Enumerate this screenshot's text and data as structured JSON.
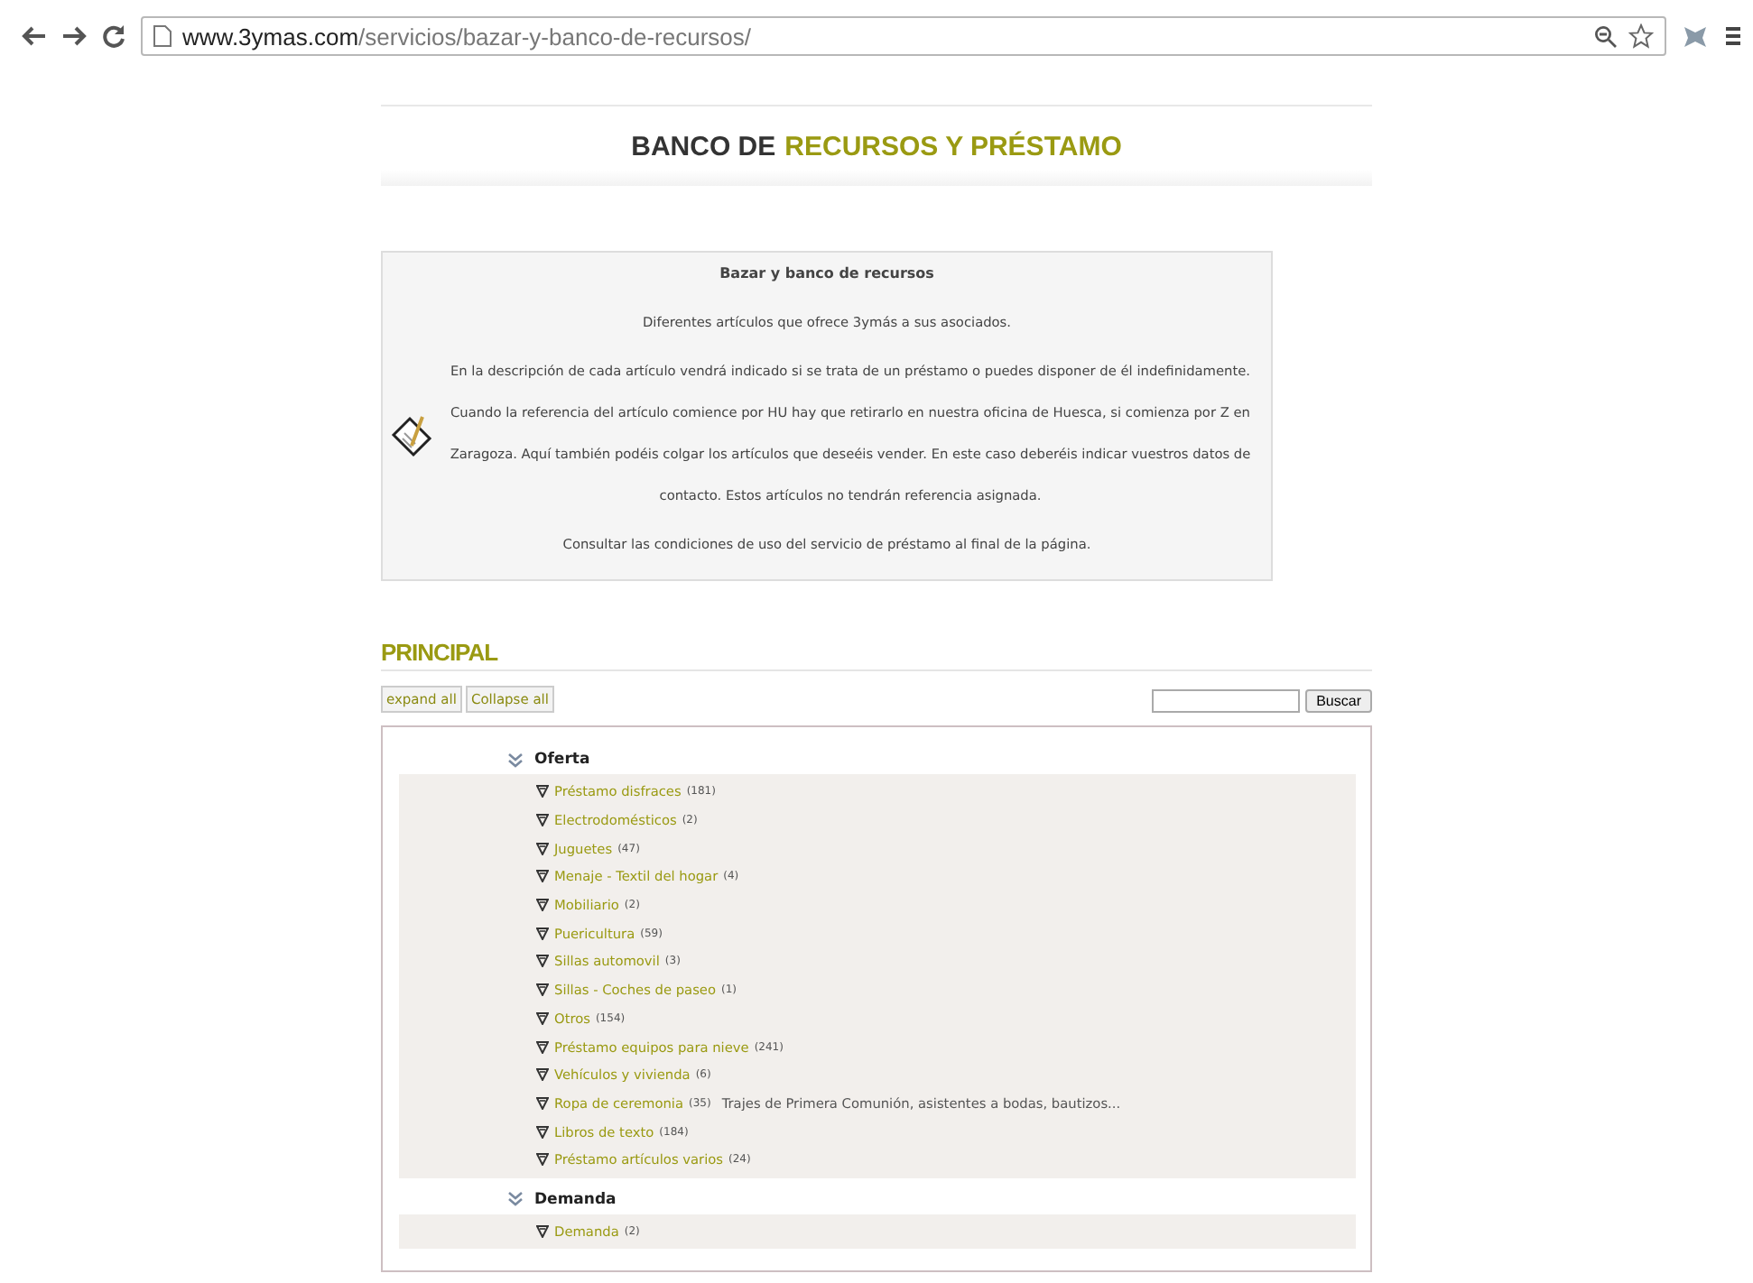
{
  "browser": {
    "url_host": "www.3ymas.com",
    "url_path": "/servicios/bazar-y-banco-de-recursos/"
  },
  "header": {
    "title_plain": "BANCO DE",
    "title_accent": "RECURSOS Y PRÉSTAMO"
  },
  "info": {
    "title": "Bazar y banco de recursos",
    "paragraphs": [
      "Diferentes artículos que ofrece 3ymás a sus asociados.",
      "En la descripción de cada artículo vendrá indicado si se trata de un préstamo o puedes disponer de él indefinidamente. Cuando la referencia del artículo comience por HU hay que retirarlo en nuestra oficina de Huesca, si comienza por Z en Zaragoza. Aquí también podéis colgar los artículos que deseéis vender. En este caso deberéis indicar vuestros datos de contacto. Estos artículos no tendrán referencia asignada.",
      "Consultar las condiciones de uso del servicio de préstamo al final de la página."
    ]
  },
  "section_title": "PRINCIPAL",
  "buttons": [
    "expand all",
    "Collapse all"
  ],
  "search": {
    "button": "Buscar"
  },
  "tree": [
    {
      "label": "Oferta",
      "expanded": true,
      "children": [
        {
          "label": "Préstamo disfraces",
          "count": "(181)"
        },
        {
          "label": "Electrodomésticos",
          "count": "(2)"
        },
        {
          "label": "Juguetes",
          "count": "(47)"
        },
        {
          "label": "Menaje - Textil del hogar",
          "count": "(4)"
        },
        {
          "label": "Mobiliario",
          "count": "(2)"
        },
        {
          "label": "Puericultura",
          "count": "(59)"
        },
        {
          "label": "Sillas automovil",
          "count": "(3)"
        },
        {
          "label": "Sillas - Coches de paseo",
          "count": "(1)"
        },
        {
          "label": "Otros",
          "count": "(154)"
        },
        {
          "label": "Préstamo equipos para nieve",
          "count": "(241)"
        },
        {
          "label": "Vehículos y vivienda",
          "count": "(6)"
        },
        {
          "label": "Ropa de ceremonia",
          "count": "(35)",
          "description": "Trajes de Primera Comunión, asistentes a bodas, bautizos..."
        },
        {
          "label": "Libros de texto",
          "count": "(184)"
        },
        {
          "label": "Préstamo artículos varios",
          "count": "(24)"
        }
      ]
    },
    {
      "label": "Demanda",
      "expanded": true,
      "children": [
        {
          "label": "Demanda",
          "count": "(2)"
        }
      ]
    }
  ]
}
